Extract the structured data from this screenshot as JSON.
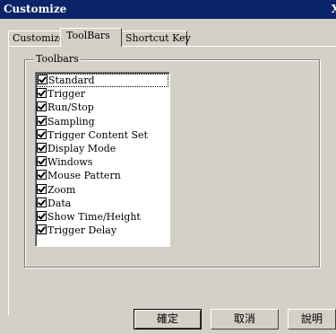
{
  "window": {
    "title": "Customize",
    "close_glyph": "X"
  },
  "tabs": [
    {
      "label": "Customize",
      "active": false
    },
    {
      "label": "ToolBars",
      "active": true
    },
    {
      "label": "Shortcut Key",
      "active": false
    }
  ],
  "toolbars": {
    "group_label": "Toolbars",
    "items": [
      {
        "label": "Standard",
        "checked": true
      },
      {
        "label": "Trigger",
        "checked": true
      },
      {
        "label": "Run/Stop",
        "checked": true
      },
      {
        "label": "Sampling",
        "checked": true
      },
      {
        "label": "Trigger Content Set",
        "checked": true
      },
      {
        "label": "Display Mode",
        "checked": true
      },
      {
        "label": "Windows",
        "checked": true
      },
      {
        "label": "Mouse Pattern",
        "checked": true
      },
      {
        "label": "Zoom",
        "checked": true
      },
      {
        "label": "Data",
        "checked": true
      },
      {
        "label": "Show Time/Height",
        "checked": true
      },
      {
        "label": "Trigger Delay",
        "checked": true
      }
    ]
  },
  "buttons": {
    "ok": "確定",
    "cancel": "取消",
    "help": "說明"
  },
  "colors": {
    "titlebar": "#0a246a",
    "face": "#d4d0c8"
  }
}
